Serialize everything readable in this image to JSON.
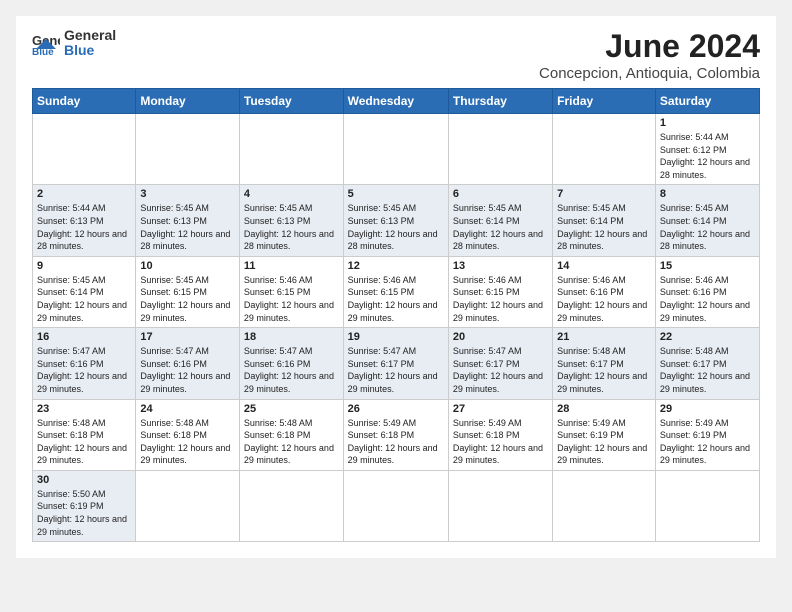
{
  "logo": {
    "general": "General",
    "blue": "Blue"
  },
  "title": "June 2024",
  "location": "Concepcion, Antioquia, Colombia",
  "days_of_week": [
    "Sunday",
    "Monday",
    "Tuesday",
    "Wednesday",
    "Thursday",
    "Friday",
    "Saturday"
  ],
  "weeks": [
    [
      {
        "day": "",
        "info": ""
      },
      {
        "day": "",
        "info": ""
      },
      {
        "day": "",
        "info": ""
      },
      {
        "day": "",
        "info": ""
      },
      {
        "day": "",
        "info": ""
      },
      {
        "day": "",
        "info": ""
      },
      {
        "day": "1",
        "info": "Sunrise: 5:44 AM\nSunset: 6:12 PM\nDaylight: 12 hours and 28 minutes."
      }
    ],
    [
      {
        "day": "2",
        "info": "Sunrise: 5:44 AM\nSunset: 6:13 PM\nDaylight: 12 hours and 28 minutes."
      },
      {
        "day": "3",
        "info": "Sunrise: 5:45 AM\nSunset: 6:13 PM\nDaylight: 12 hours and 28 minutes."
      },
      {
        "day": "4",
        "info": "Sunrise: 5:45 AM\nSunset: 6:13 PM\nDaylight: 12 hours and 28 minutes."
      },
      {
        "day": "5",
        "info": "Sunrise: 5:45 AM\nSunset: 6:13 PM\nDaylight: 12 hours and 28 minutes."
      },
      {
        "day": "6",
        "info": "Sunrise: 5:45 AM\nSunset: 6:14 PM\nDaylight: 12 hours and 28 minutes."
      },
      {
        "day": "7",
        "info": "Sunrise: 5:45 AM\nSunset: 6:14 PM\nDaylight: 12 hours and 28 minutes."
      },
      {
        "day": "8",
        "info": "Sunrise: 5:45 AM\nSunset: 6:14 PM\nDaylight: 12 hours and 28 minutes."
      }
    ],
    [
      {
        "day": "9",
        "info": "Sunrise: 5:45 AM\nSunset: 6:14 PM\nDaylight: 12 hours and 29 minutes."
      },
      {
        "day": "10",
        "info": "Sunrise: 5:45 AM\nSunset: 6:15 PM\nDaylight: 12 hours and 29 minutes."
      },
      {
        "day": "11",
        "info": "Sunrise: 5:46 AM\nSunset: 6:15 PM\nDaylight: 12 hours and 29 minutes."
      },
      {
        "day": "12",
        "info": "Sunrise: 5:46 AM\nSunset: 6:15 PM\nDaylight: 12 hours and 29 minutes."
      },
      {
        "day": "13",
        "info": "Sunrise: 5:46 AM\nSunset: 6:15 PM\nDaylight: 12 hours and 29 minutes."
      },
      {
        "day": "14",
        "info": "Sunrise: 5:46 AM\nSunset: 6:16 PM\nDaylight: 12 hours and 29 minutes."
      },
      {
        "day": "15",
        "info": "Sunrise: 5:46 AM\nSunset: 6:16 PM\nDaylight: 12 hours and 29 minutes."
      }
    ],
    [
      {
        "day": "16",
        "info": "Sunrise: 5:47 AM\nSunset: 6:16 PM\nDaylight: 12 hours and 29 minutes."
      },
      {
        "day": "17",
        "info": "Sunrise: 5:47 AM\nSunset: 6:16 PM\nDaylight: 12 hours and 29 minutes."
      },
      {
        "day": "18",
        "info": "Sunrise: 5:47 AM\nSunset: 6:16 PM\nDaylight: 12 hours and 29 minutes."
      },
      {
        "day": "19",
        "info": "Sunrise: 5:47 AM\nSunset: 6:17 PM\nDaylight: 12 hours and 29 minutes."
      },
      {
        "day": "20",
        "info": "Sunrise: 5:47 AM\nSunset: 6:17 PM\nDaylight: 12 hours and 29 minutes."
      },
      {
        "day": "21",
        "info": "Sunrise: 5:48 AM\nSunset: 6:17 PM\nDaylight: 12 hours and 29 minutes."
      },
      {
        "day": "22",
        "info": "Sunrise: 5:48 AM\nSunset: 6:17 PM\nDaylight: 12 hours and 29 minutes."
      }
    ],
    [
      {
        "day": "23",
        "info": "Sunrise: 5:48 AM\nSunset: 6:18 PM\nDaylight: 12 hours and 29 minutes."
      },
      {
        "day": "24",
        "info": "Sunrise: 5:48 AM\nSunset: 6:18 PM\nDaylight: 12 hours and 29 minutes."
      },
      {
        "day": "25",
        "info": "Sunrise: 5:48 AM\nSunset: 6:18 PM\nDaylight: 12 hours and 29 minutes."
      },
      {
        "day": "26",
        "info": "Sunrise: 5:49 AM\nSunset: 6:18 PM\nDaylight: 12 hours and 29 minutes."
      },
      {
        "day": "27",
        "info": "Sunrise: 5:49 AM\nSunset: 6:18 PM\nDaylight: 12 hours and 29 minutes."
      },
      {
        "day": "28",
        "info": "Sunrise: 5:49 AM\nSunset: 6:19 PM\nDaylight: 12 hours and 29 minutes."
      },
      {
        "day": "29",
        "info": "Sunrise: 5:49 AM\nSunset: 6:19 PM\nDaylight: 12 hours and 29 minutes."
      }
    ],
    [
      {
        "day": "30",
        "info": "Sunrise: 5:50 AM\nSunset: 6:19 PM\nDaylight: 12 hours and 29 minutes."
      },
      {
        "day": "",
        "info": ""
      },
      {
        "day": "",
        "info": ""
      },
      {
        "day": "",
        "info": ""
      },
      {
        "day": "",
        "info": ""
      },
      {
        "day": "",
        "info": ""
      },
      {
        "day": "",
        "info": ""
      }
    ]
  ]
}
